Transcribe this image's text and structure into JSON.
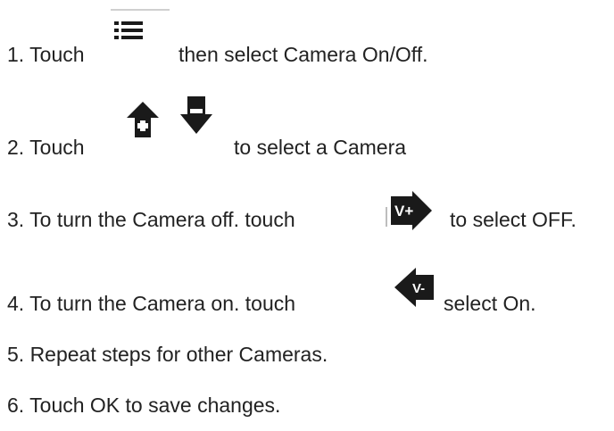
{
  "steps": [
    {
      "before": "1. Touch",
      "after": "then select Camera On/Off.",
      "icons": [
        "menu-list-icon"
      ]
    },
    {
      "before": "2. Touch",
      "after": "to select a Camera",
      "icons": [
        "up-arrow-icon",
        "down-arrow-icon"
      ]
    },
    {
      "before": "3. To turn the Camera off. touch",
      "after": "to select OFF.",
      "icons": [
        "value-plus-icon"
      ]
    },
    {
      "before": "4. To turn the Camera on. touch",
      "after": "select On.",
      "icons": [
        "value-minus-icon"
      ]
    },
    {
      "text": "5. Repeat steps for other Cameras."
    },
    {
      "text": "6. Touch OK to save changes."
    }
  ],
  "icon_glyphs": {
    "value_plus": "V+",
    "value_minus": "V-"
  },
  "colors": {
    "text": "#222222",
    "icon": "#1a1a1a"
  }
}
